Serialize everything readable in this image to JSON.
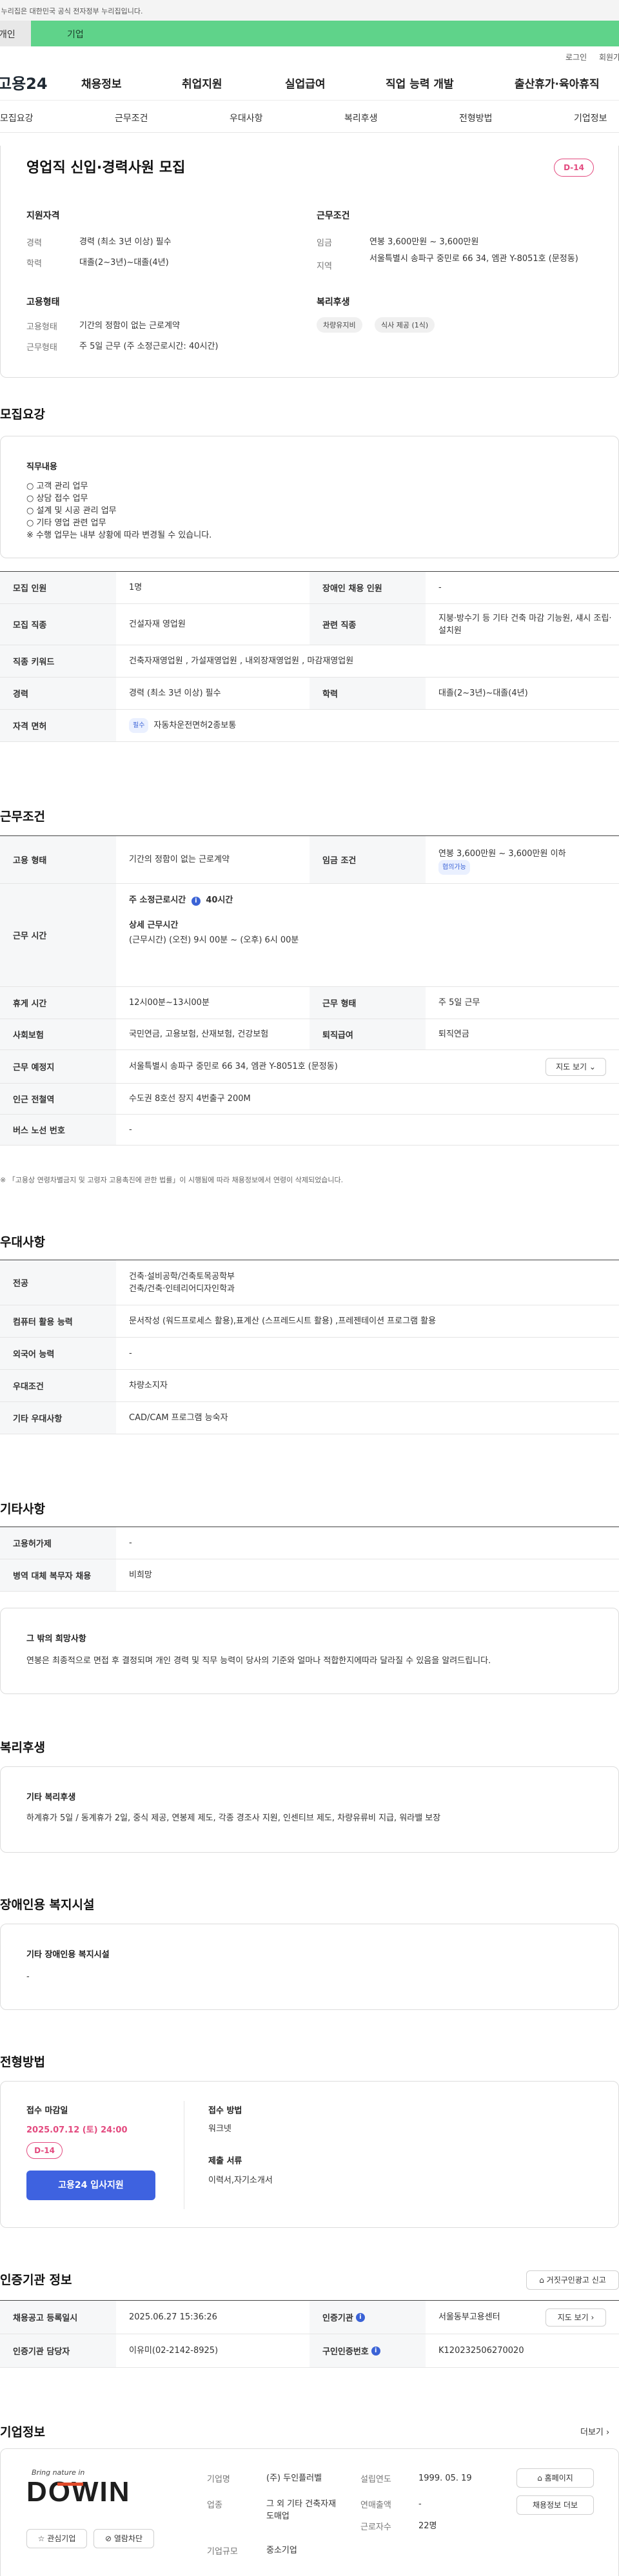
{
  "gov_notice": "이 누리집은 대한민국 공식 전자정부 누리집입니다.",
  "top_tabs": {
    "personal": "개인",
    "company": "기업"
  },
  "util": {
    "login": "로그인",
    "join": "회원가입"
  },
  "gnb": {
    "logo": "고용24",
    "menus": [
      "채용정보",
      "취업지원",
      "실업급여",
      "직업 능력 개발",
      "출산휴가·육아휴직"
    ]
  },
  "subnav": [
    "모집요강",
    "근무조건",
    "우대사항",
    "복리후생",
    "전형방법",
    "기업정보"
  ],
  "summary": {
    "title": "영업직 신입·경력사원 모집",
    "dday": "D-14",
    "qual_heading": "지원자격",
    "career_label": "경력",
    "career_value": "경력 (최소 3년 이상) 필수",
    "edu_label": "학력",
    "edu_value": "대졸(2~3년)~대졸(4년)",
    "cond_heading": "근무조건",
    "wage_label": "임금",
    "wage_value": "연봉 3,600만원 ~ 3,600만원",
    "region_label": "지역",
    "region_value": "서울특별시 송파구 중민로 66 34, 엠관 Y-8051호 (문정동)",
    "emp_heading": "고용형태",
    "emp_type_label": "고용형태",
    "emp_type_value": "기간의 정함이 없는 근로계약",
    "work_type_label": "근무형태",
    "work_type_value": "주 5일 근무 (주 소정근로시간: 40시간)",
    "welfare_heading": "복리후생",
    "welfare_chips": [
      "차량유지비",
      "식사 제공 (1식)"
    ]
  },
  "recruit": {
    "section_title": "모집요강",
    "duties_heading": "직무내용",
    "duties": [
      "○ 고객 관리 업무",
      "○ 상담 접수 업무",
      "○ 설계 및 시공 관리 업무",
      "○ 기타 영업 관련 업무",
      "※ 수행 업무는 내부 상황에 따라 변경될 수 있습니다."
    ],
    "rows": {
      "count_label": "모집 인원",
      "count_value": "1명",
      "disabled_label": "장애인 채용 인원",
      "disabled_value": "-",
      "job_label": "모집 직종",
      "job_value": "건설자재 영업원",
      "related_label": "관련 직종",
      "related_value": "지붕·방수기 등 기타 건축 마감 기능원, 섀시 조립·설치원",
      "keyword_label": "직종 키워드",
      "keyword_value": "건축자재영업원 , 가설재영업원 , 내외장재영업원 , 마감재영업원",
      "career_label": "경력",
      "career_value": "경력 (최소 3년 이상) 필수",
      "edu_label": "학력",
      "edu_value": "대졸(2~3년)~대졸(4년)",
      "license_label": "자격 면허",
      "license_badge": "필수",
      "license_value": "자동차운전면허2종보통"
    }
  },
  "conditions": {
    "section_title": "근무조건",
    "emp_label": "고용 형태",
    "emp_value": "기간의 정함이 없는 근로계약",
    "wage_label": "임금 조건",
    "wage_value": "연봉 3,600만원 ~ 3,600만원 이하",
    "wage_badge": "협의가능",
    "hours_label": "근무 시간",
    "hours_line1_prefix": "주 소정근로시간",
    "hours_line1_value": "40시간",
    "hours_line2": "상세 근무시간",
    "hours_line3": "(근무시간) (오전) 9시 00분 ~ (오후) 6시 00분",
    "rest_label": "휴게 시간",
    "rest_value": "12시00분~13시00분",
    "worktype_label": "근무 형태",
    "worktype_value": "주 5일 근무",
    "insurance_label": "사회보험",
    "insurance_value": "국민연금, 고용보험, 산재보험, 건강보험",
    "retire_label": "퇴직급여",
    "retire_value": "퇴직연금",
    "place_label": "근무 예정지",
    "place_value": "서울특별시 송파구 중민로 66 34, 엠관 Y-8051호 (문정동)",
    "map_button": "지도 보기",
    "subway_label": "인근 전철역",
    "subway_value": "수도권 8호선 장지 4번출구 200M",
    "bus_label": "버스 노선 번호",
    "bus_value": "-",
    "footnote": "※ 「고용상 연령차별금지 및 고령자 고용촉진에 관한 법률」이 시행됨에 따라 채용정보에서 연령이 삭제되었습니다."
  },
  "preference": {
    "section_title": "우대사항",
    "major_label": "전공",
    "major_value1": "건축·설비공학/건축토목공학부",
    "major_value2": "건축/건축·인테리어디자인학과",
    "computer_label": "컴퓨터 활용 능력",
    "computer_value": "문서작성 (워드프로세스 활용),표계산 (스프레드시트 활용) ,프레젠테이션 프로그램 활용",
    "language_label": "외국어 능력",
    "language_value": "-",
    "cond_label": "우대조건",
    "cond_value": "차량소지자",
    "etc_label": "기타 우대사항",
    "etc_value": "CAD/CAM 프로그램 능숙자"
  },
  "etc": {
    "section_title": "기타사항",
    "insurance_label": "고용허가제",
    "insurance_value": "-",
    "military_label": "병역 대체 복무자 채용",
    "military_value": "비희망",
    "hope_heading": "그 밖의 희망사항",
    "hope_text": "연봉은 최종적으로 면접 후 결정되며 개인 경력 및 직무 능력이 당사의 기준와 얼마나 적합한지에따라 달라질 수 있음을 알려드립니다."
  },
  "welfare": {
    "section_title": "복리후생",
    "heading": "기타 복리후생",
    "text": "하계휴가 5일 / 동계휴가 2일, 중식 제공, 연봉제 제도, 각종 경조사 지원, 인센티브 제도, 차량유류비 지급, 워라밸 보장"
  },
  "disabled": {
    "section_title": "장애인용 복지시설",
    "heading": "기타 장애인용 복지시설",
    "value": "-"
  },
  "process": {
    "section_title": "전형방법",
    "deadline_heading": "접수 마감일",
    "deadline_value": "2025.07.12 (토) 24:00",
    "dday": "D-14",
    "apply_button": "고용24 입사지원",
    "method_heading": "접수 방법",
    "method_value": "워크넷",
    "docs_heading": "제출 서류",
    "docs_value": "이력서,자기소개서"
  },
  "agency": {
    "section_title": "인증기관 정보",
    "report_button": "거짓구인광고 신고",
    "reg_label": "채용공고 등록일시",
    "reg_value": "2025.06.27 15:36:26",
    "agency_label": "인증기관",
    "agency_value": "서울동부고용센터",
    "map_button": "지도 보기",
    "manager_label": "인증기관 담당자",
    "manager_value": "이유미(02-2142-8925)",
    "number_label": "구인인증번호",
    "number_value": "K120232506270020"
  },
  "company": {
    "section_title": "기업정보",
    "more": "더보기",
    "logo_tagline": "Bring nature in",
    "logo_text": "DOWIN",
    "fav_button": "관심기업",
    "block_button": "열람차단",
    "name_label": "기업명",
    "name_value": "(주) 두인플러벨",
    "industry_label": "업종",
    "industry_value": "그 외 기타 건축자재 도매업",
    "size_label": "기업규모",
    "size_value": "중소기업",
    "founded_label": "설립연도",
    "founded_value": "1999. 05. 19",
    "revenue_label": "연매출액",
    "revenue_value": "-",
    "employees_label": "근로자수",
    "employees_value": "22명",
    "homepage_button": "홈페이지",
    "jobs_button": "채용정보 더보"
  }
}
